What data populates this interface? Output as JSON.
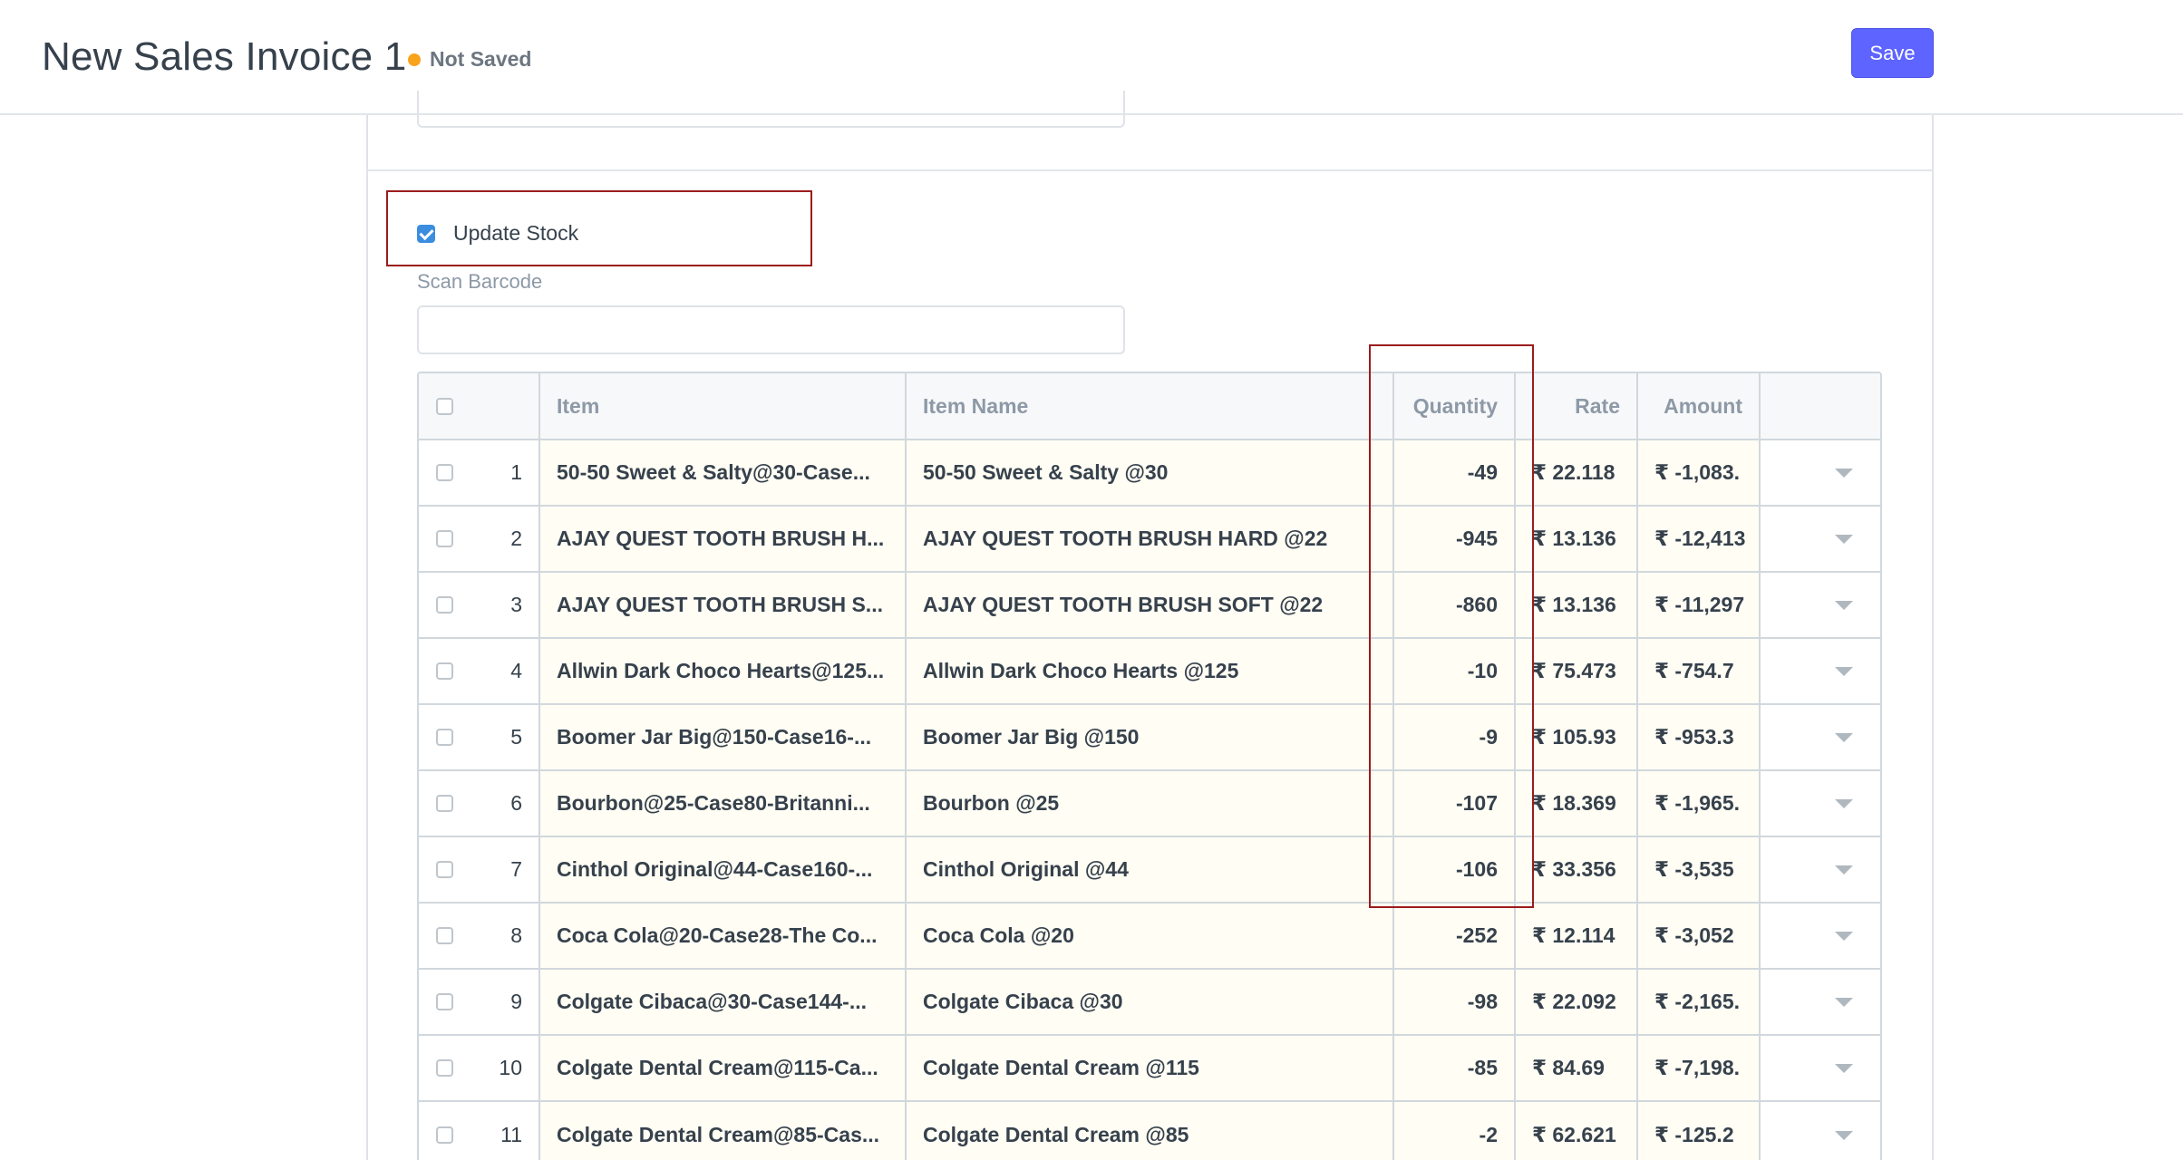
{
  "header": {
    "title": "New Sales Invoice 1",
    "status": "Not Saved",
    "save_label": "Save"
  },
  "stock": {
    "update_stock_label": "Update Stock",
    "update_stock_checked": true
  },
  "barcode": {
    "label": "Scan Barcode",
    "value": ""
  },
  "items_table": {
    "columns": [
      "Item",
      "Item Name",
      "Quantity",
      "Rate",
      "Amount"
    ],
    "rows": [
      {
        "idx": "1",
        "item": "50-50 Sweet & Salty@30-Case...",
        "item_name": "50-50 Sweet & Salty @30",
        "qty": "-49",
        "rate": "₹ 22.118",
        "amount": "₹ -1,083."
      },
      {
        "idx": "2",
        "item": "AJAY QUEST TOOTH BRUSH H...",
        "item_name": "AJAY QUEST TOOTH BRUSH HARD @22",
        "qty": "-945",
        "rate": "₹ 13.136",
        "amount": "₹ -12,413"
      },
      {
        "idx": "3",
        "item": "AJAY QUEST TOOTH BRUSH S...",
        "item_name": "AJAY QUEST TOOTH BRUSH SOFT @22",
        "qty": "-860",
        "rate": "₹ 13.136",
        "amount": "₹ -11,297"
      },
      {
        "idx": "4",
        "item": "Allwin Dark Choco Hearts@125...",
        "item_name": "Allwin Dark Choco Hearts @125",
        "qty": "-10",
        "rate": "₹ 75.473",
        "amount": "₹ -754.7"
      },
      {
        "idx": "5",
        "item": "Boomer Jar Big@150-Case16-...",
        "item_name": "Boomer Jar Big @150",
        "qty": "-9",
        "rate": "₹ 105.93",
        "amount": "₹ -953.3"
      },
      {
        "idx": "6",
        "item": "Bourbon@25-Case80-Britanni...",
        "item_name": "Bourbon @25",
        "qty": "-107",
        "rate": "₹ 18.369",
        "amount": "₹ -1,965."
      },
      {
        "idx": "7",
        "item": "Cinthol Original@44-Case160-...",
        "item_name": "Cinthol Original @44",
        "qty": "-106",
        "rate": "₹ 33.356",
        "amount": "₹ -3,535"
      },
      {
        "idx": "8",
        "item": "Coca Cola@20-Case28-The Co...",
        "item_name": "Coca Cola @20",
        "qty": "-252",
        "rate": "₹ 12.114",
        "amount": "₹ -3,052"
      },
      {
        "idx": "9",
        "item": "Colgate Cibaca@30-Case144-...",
        "item_name": "Colgate Cibaca @30",
        "qty": "-98",
        "rate": "₹ 22.092",
        "amount": "₹ -2,165."
      },
      {
        "idx": "10",
        "item": "Colgate Dental Cream@115-Ca...",
        "item_name": "Colgate Dental Cream @115",
        "qty": "-85",
        "rate": "₹ 84.69",
        "amount": "₹ -7,198."
      },
      {
        "idx": "11",
        "item": "Colgate Dental Cream@85-Cas...",
        "item_name": "Colgate Dental Cream @85",
        "qty": "-2",
        "rate": "₹ 62.621",
        "amount": "₹ -125.2"
      }
    ]
  },
  "colors": {
    "primary": "#5e64ff",
    "status_dot": "#f9a31c",
    "highlight": "#9b1c1c",
    "checkbox": "#3b8de0"
  }
}
